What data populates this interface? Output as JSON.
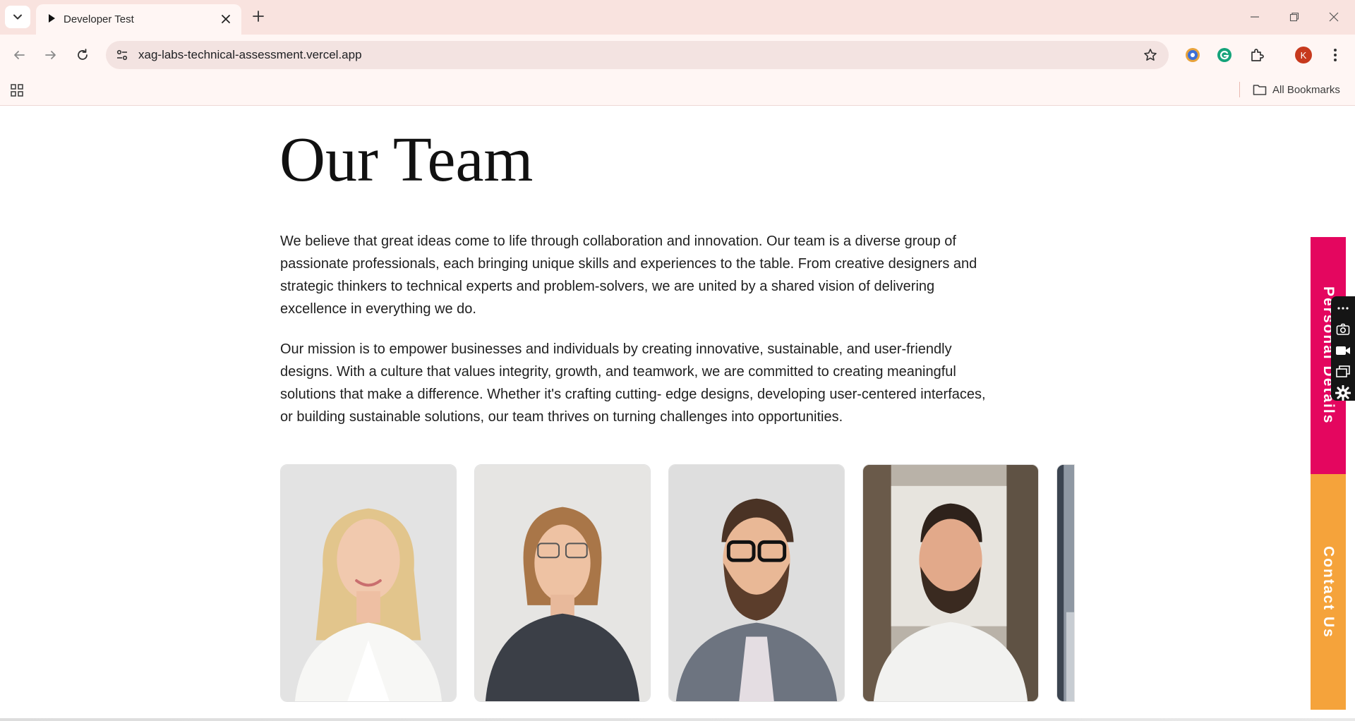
{
  "browser": {
    "tab": {
      "title": "Developer Test"
    },
    "url": "xag-labs-technical-assessment.vercel.app",
    "profile_initial": "K",
    "bookmarks_label": "All Bookmarks"
  },
  "page": {
    "title": "Our Team",
    "paragraphs": [
      "We believe that great ideas come to life through collaboration and innovation. Our team is a diverse group of passionate professionals, each bringing unique skills and experiences to the table. From creative designers and strategic thinkers to technical experts and problem-solvers, we are united by a shared vision of delivering excellence in everything we do.",
      "Our mission is to empower businesses and individuals by creating innovative, sustainable, and user-friendly designs. With a culture that values integrity, growth, and teamwork, we are committed to creating meaningful solutions that make a difference. Whether it's crafting cutting- edge designs, developing user-centered interfaces, or building sustainable solutions, our team thrives on turning challenges into opportunities."
    ],
    "side_tabs": {
      "personal": "Personal Details",
      "contact": "Contact Us"
    }
  },
  "colors": {
    "personal_tab": "#e4065f",
    "contact_tab": "#f5a33b",
    "tab_strip": "#f9e3df",
    "toolbar": "#fff6f4"
  }
}
